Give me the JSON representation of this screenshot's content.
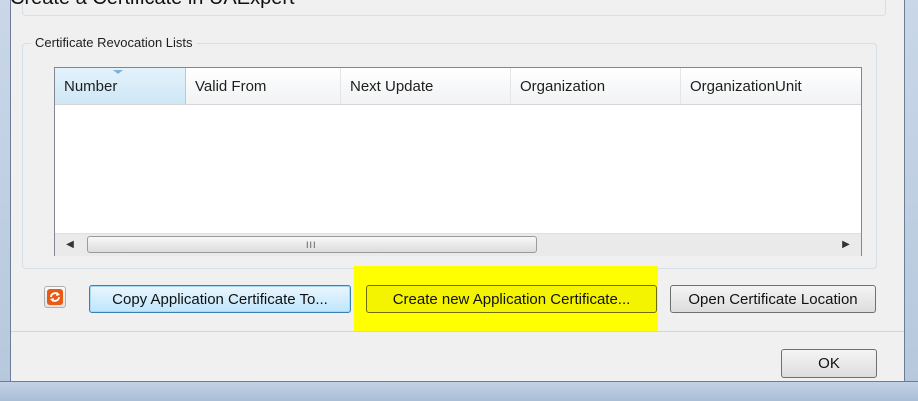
{
  "caption": "Create a Certificate in UAExpert",
  "crl_group": {
    "title": "Certificate Revocation Lists",
    "columns": [
      "Number",
      "Valid From",
      "Next Update",
      "Organization",
      "OrganizationUnit"
    ],
    "sorted_column": "Number",
    "rows": [],
    "scroll_grip": "III"
  },
  "buttons": {
    "copy_app_cert": "Copy Application Certificate To...",
    "create_app_cert": "Create new Application Certificate...",
    "open_cert_location": "Open Certificate Location",
    "ok": "OK"
  },
  "highlight_color": "#ffff00"
}
